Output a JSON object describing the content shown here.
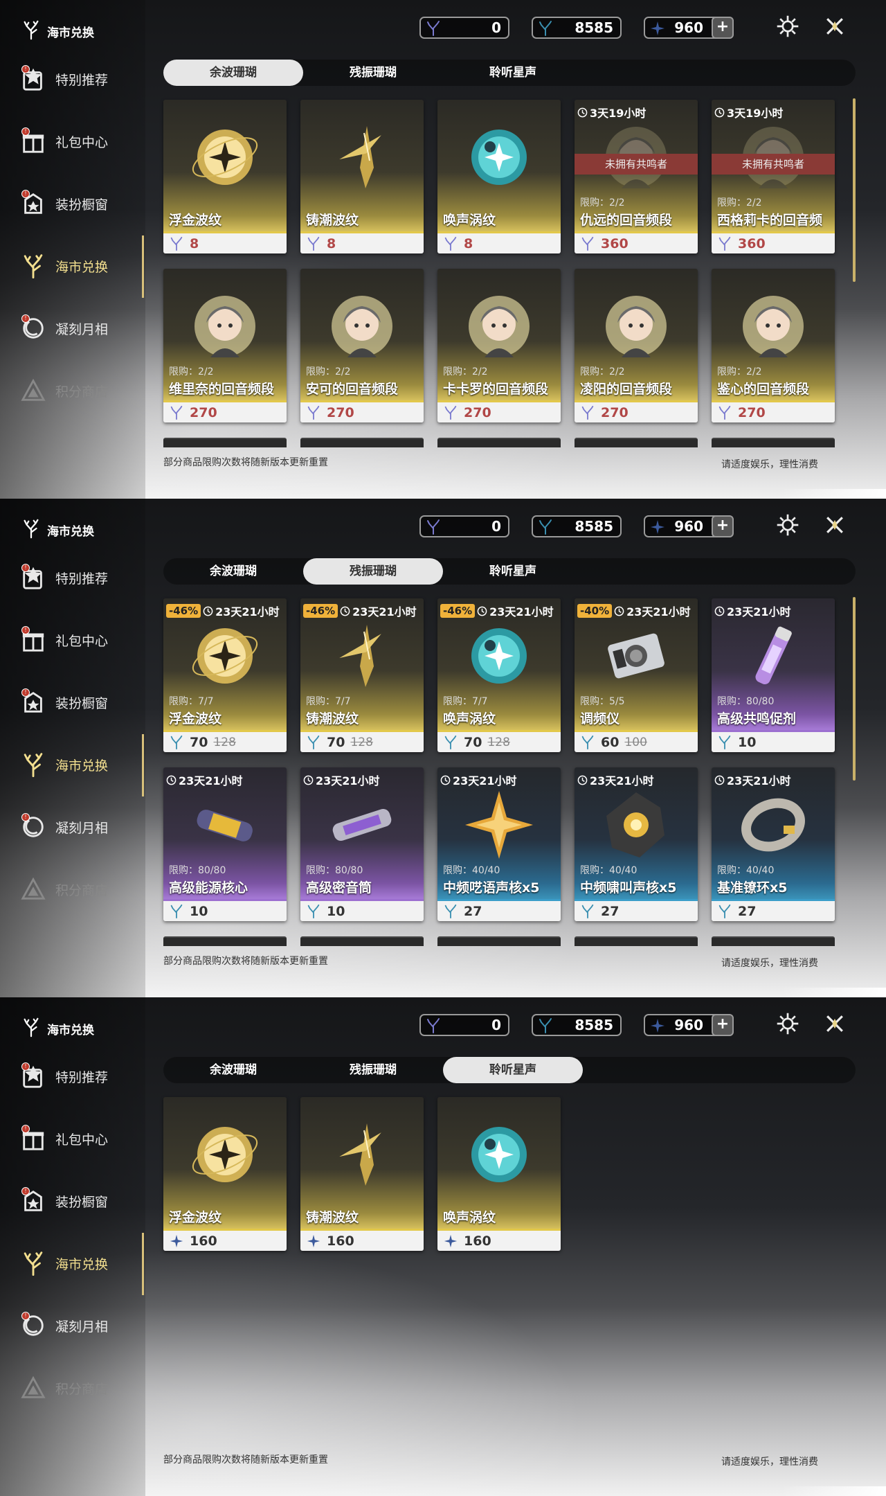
{
  "logo_title": "海市兑换",
  "nav": [
    "特别推荐",
    "礼包中心",
    "装扮橱窗",
    "海市兑换",
    "凝刻月相",
    "积分商店"
  ],
  "currency": {
    "a": "0",
    "b": "8585",
    "c": "960",
    "plus": "+"
  },
  "tabs": [
    "余波珊瑚",
    "残振珊瑚",
    "聆听星声"
  ],
  "footer_left": "部分商品限购次数将随新版本更新重置",
  "footer_right": "请适度娱乐，理性消费",
  "icons": {
    "logo": "coral-icon",
    "featured": "star-tag-icon",
    "gift": "gift-icon",
    "wardrobe": "wardrobe-icon",
    "exchange": "coral-icon",
    "moon": "moon-icon",
    "points": "triangle-icon",
    "settings": "gear-icon",
    "close": "close-icon"
  },
  "colors": {
    "accent": "#f3df8f",
    "gold": "#e2c84a",
    "purple": "#9c6fd0",
    "blue": "#3a9dc9",
    "warn": "#8a3a36",
    "discount": "#f0b23a"
  },
  "panels": [
    {
      "active_tab": 0,
      "cards": [
        {
          "name": "浮金波纹",
          "price": "8",
          "tone": "gold",
          "art": "orb-gold",
          "red": true
        },
        {
          "name": "铸潮波纹",
          "price": "8",
          "tone": "gold",
          "art": "blade",
          "red": true
        },
        {
          "name": "唤声涡纹",
          "price": "8",
          "tone": "gold",
          "art": "orb-cyan",
          "red": true
        },
        {
          "name": "仇远的回音频段",
          "price": "360",
          "tone": "gold",
          "art": "portrait",
          "timer": "3天19小时",
          "limit": "限购：2/2",
          "warn": "未拥有共鸣者",
          "red": true
        },
        {
          "name": "西格莉卡的回音频段",
          "price": "360",
          "tone": "gold",
          "art": "portrait",
          "timer": "3天19小时",
          "limit": "限购：2/2",
          "warn": "未拥有共鸣者",
          "red": true
        },
        {
          "name": "维里奈的回音频段",
          "price": "270",
          "tone": "gold",
          "art": "portrait",
          "limit": "限购：2/2",
          "red": true
        },
        {
          "name": "安可的回音频段",
          "price": "270",
          "tone": "gold",
          "art": "portrait",
          "limit": "限购：2/2",
          "red": true
        },
        {
          "name": "卡卡罗的回音频段",
          "price": "270",
          "tone": "gold",
          "art": "portrait",
          "limit": "限购：2/2",
          "red": true
        },
        {
          "name": "凌阳的回音频段",
          "price": "270",
          "tone": "gold",
          "art": "portrait",
          "limit": "限购：2/2",
          "red": true
        },
        {
          "name": "鉴心的回音频段",
          "price": "270",
          "tone": "gold",
          "art": "portrait",
          "limit": "限购：2/2",
          "red": true
        }
      ]
    },
    {
      "active_tab": 1,
      "cards": [
        {
          "name": "浮金波纹",
          "price": "70",
          "old": "128",
          "tone": "gold",
          "art": "orb-gold",
          "timer": "23天21小时",
          "discount": "-46%",
          "limit": "限购：7/7"
        },
        {
          "name": "铸潮波纹",
          "price": "70",
          "old": "128",
          "tone": "gold",
          "art": "blade",
          "timer": "23天21小时",
          "discount": "-46%",
          "limit": "限购：7/7"
        },
        {
          "name": "唤声涡纹",
          "price": "70",
          "old": "128",
          "tone": "gold",
          "art": "orb-cyan",
          "timer": "23天21小时",
          "discount": "-46%",
          "limit": "限购：7/7"
        },
        {
          "name": "调频仪",
          "price": "60",
          "old": "100",
          "tone": "gold",
          "art": "device",
          "timer": "23天21小时",
          "discount": "-40%",
          "limit": "限购：5/5"
        },
        {
          "name": "高级共鸣促剂",
          "price": "10",
          "tone": "purple",
          "art": "vial",
          "timer": "23天21小时",
          "limit": "限购：80/80"
        },
        {
          "name": "高级能源核心",
          "price": "10",
          "tone": "purple",
          "art": "capsule",
          "timer": "23天21小时",
          "limit": "限购：80/80"
        },
        {
          "name": "高级密音筒",
          "price": "10",
          "tone": "purple",
          "art": "tube",
          "timer": "23天21小时",
          "limit": "限购：80/80"
        },
        {
          "name": "中频呓语声核x5",
          "price": "27",
          "tone": "blue",
          "art": "star",
          "timer": "23天21小时",
          "limit": "限购：40/40"
        },
        {
          "name": "中频啸叫声核x5",
          "price": "27",
          "tone": "blue",
          "art": "core",
          "timer": "23天21小时",
          "limit": "限购：40/40"
        },
        {
          "name": "基准镣环x5",
          "price": "27",
          "tone": "blue",
          "art": "ring",
          "timer": "23天21小时",
          "limit": "限购：40/40"
        }
      ]
    },
    {
      "active_tab": 2,
      "cards": [
        {
          "name": "浮金波纹",
          "price": "160",
          "tone": "gold",
          "art": "orb-gold"
        },
        {
          "name": "铸潮波纹",
          "price": "160",
          "tone": "gold",
          "art": "blade"
        },
        {
          "name": "唤声涡纹",
          "price": "160",
          "tone": "gold",
          "art": "orb-cyan"
        }
      ]
    }
  ]
}
